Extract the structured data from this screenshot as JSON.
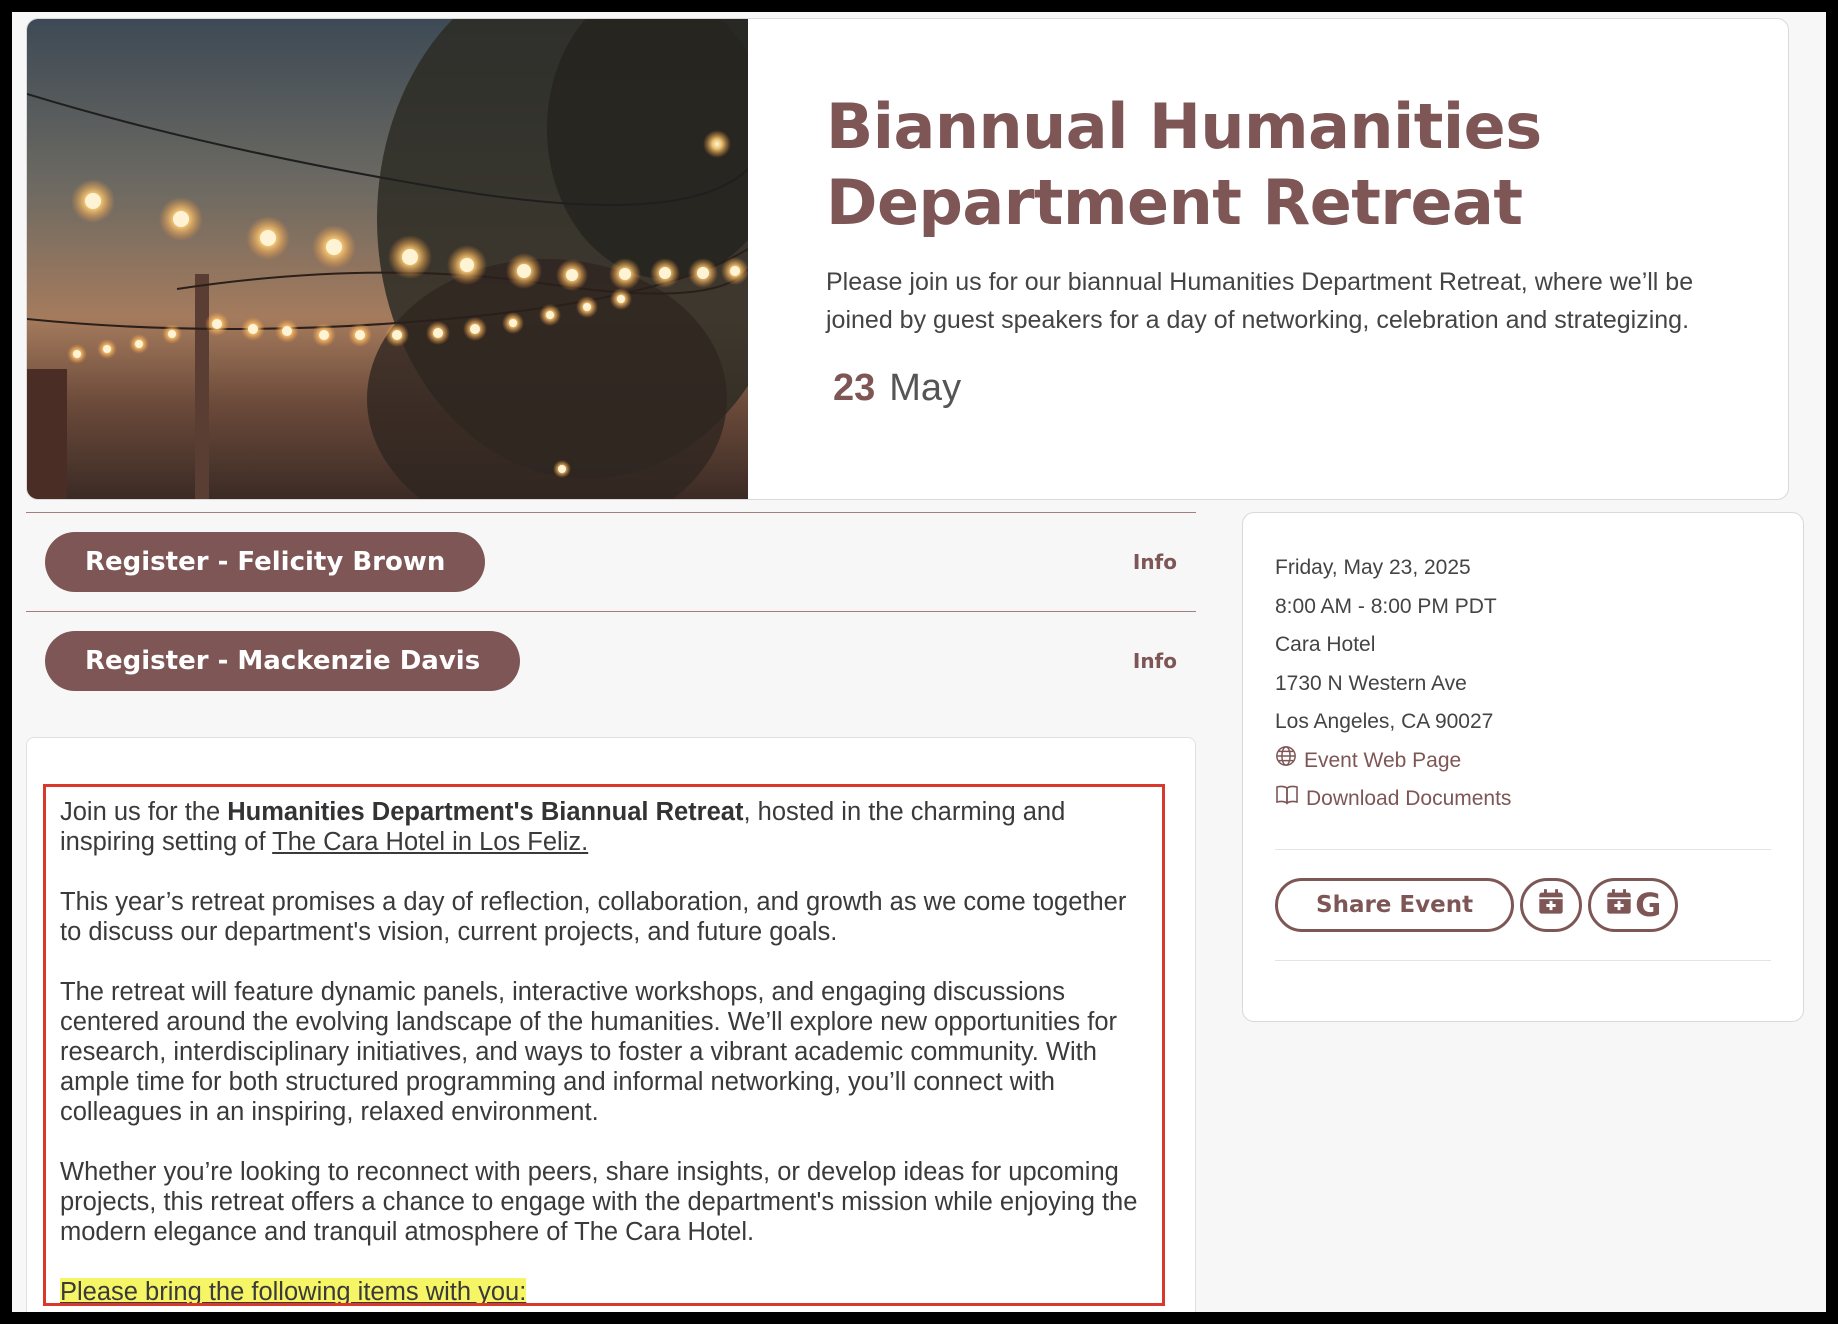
{
  "hero": {
    "title_line1": "Biannual Humanities",
    "title_line2": "Department Retreat",
    "description": "Please join us for our biannual Humanities Department Retreat, where we’ll be joined by guest speakers for a day of networking, celebration and strategizing.",
    "date_day": "23",
    "date_month": "May"
  },
  "registrations": [
    {
      "label": "Register - Felicity Brown",
      "info": "Info"
    },
    {
      "label": "Register - Mackenzie Davis",
      "info": "Info"
    }
  ],
  "details": {
    "date": "Friday, May 23, 2025",
    "time": "8:00 AM - 8:00 PM PDT",
    "venue": "Cara Hotel",
    "street": "1730 N Western Ave",
    "city": "Los Angeles, CA 90027",
    "web_link": "Event Web Page",
    "docs_link": "Download Documents",
    "share_label": "Share Event",
    "google_letter": "G",
    "accent_color": "#7e5656"
  },
  "description": {
    "p1_pre": "Join us for the ",
    "p1_bold": "Humanities Department's Biannual Retreat",
    "p1_mid": ", hosted in the charming and inspiring setting of ",
    "p1_link": "The Cara Hotel in Los Feliz.",
    "p2": "This year’s retreat promises a day of reflection, collaboration, and growth as we come together to discuss our department's vision, current projects, and future goals.",
    "p3": "The retreat will feature dynamic panels, interactive workshops, and engaging discussions centered around the evolving landscape of the humanities. We’ll explore new opportunities for research, interdisciplinary initiatives, and ways to foster a vibrant academic community. With ample time for both structured programming and informal networking, you’ll connect with colleagues in an inspiring, relaxed environment.",
    "p4": "Whether you’re looking to reconnect with peers, share insights, or develop ideas for upcoming projects, this retreat offers a chance to engage with the department's mission while enjoying the modern elegance and tranquil atmosphere of The Cara Hotel.",
    "p5_highlight": "Please bring the following items with you:"
  }
}
